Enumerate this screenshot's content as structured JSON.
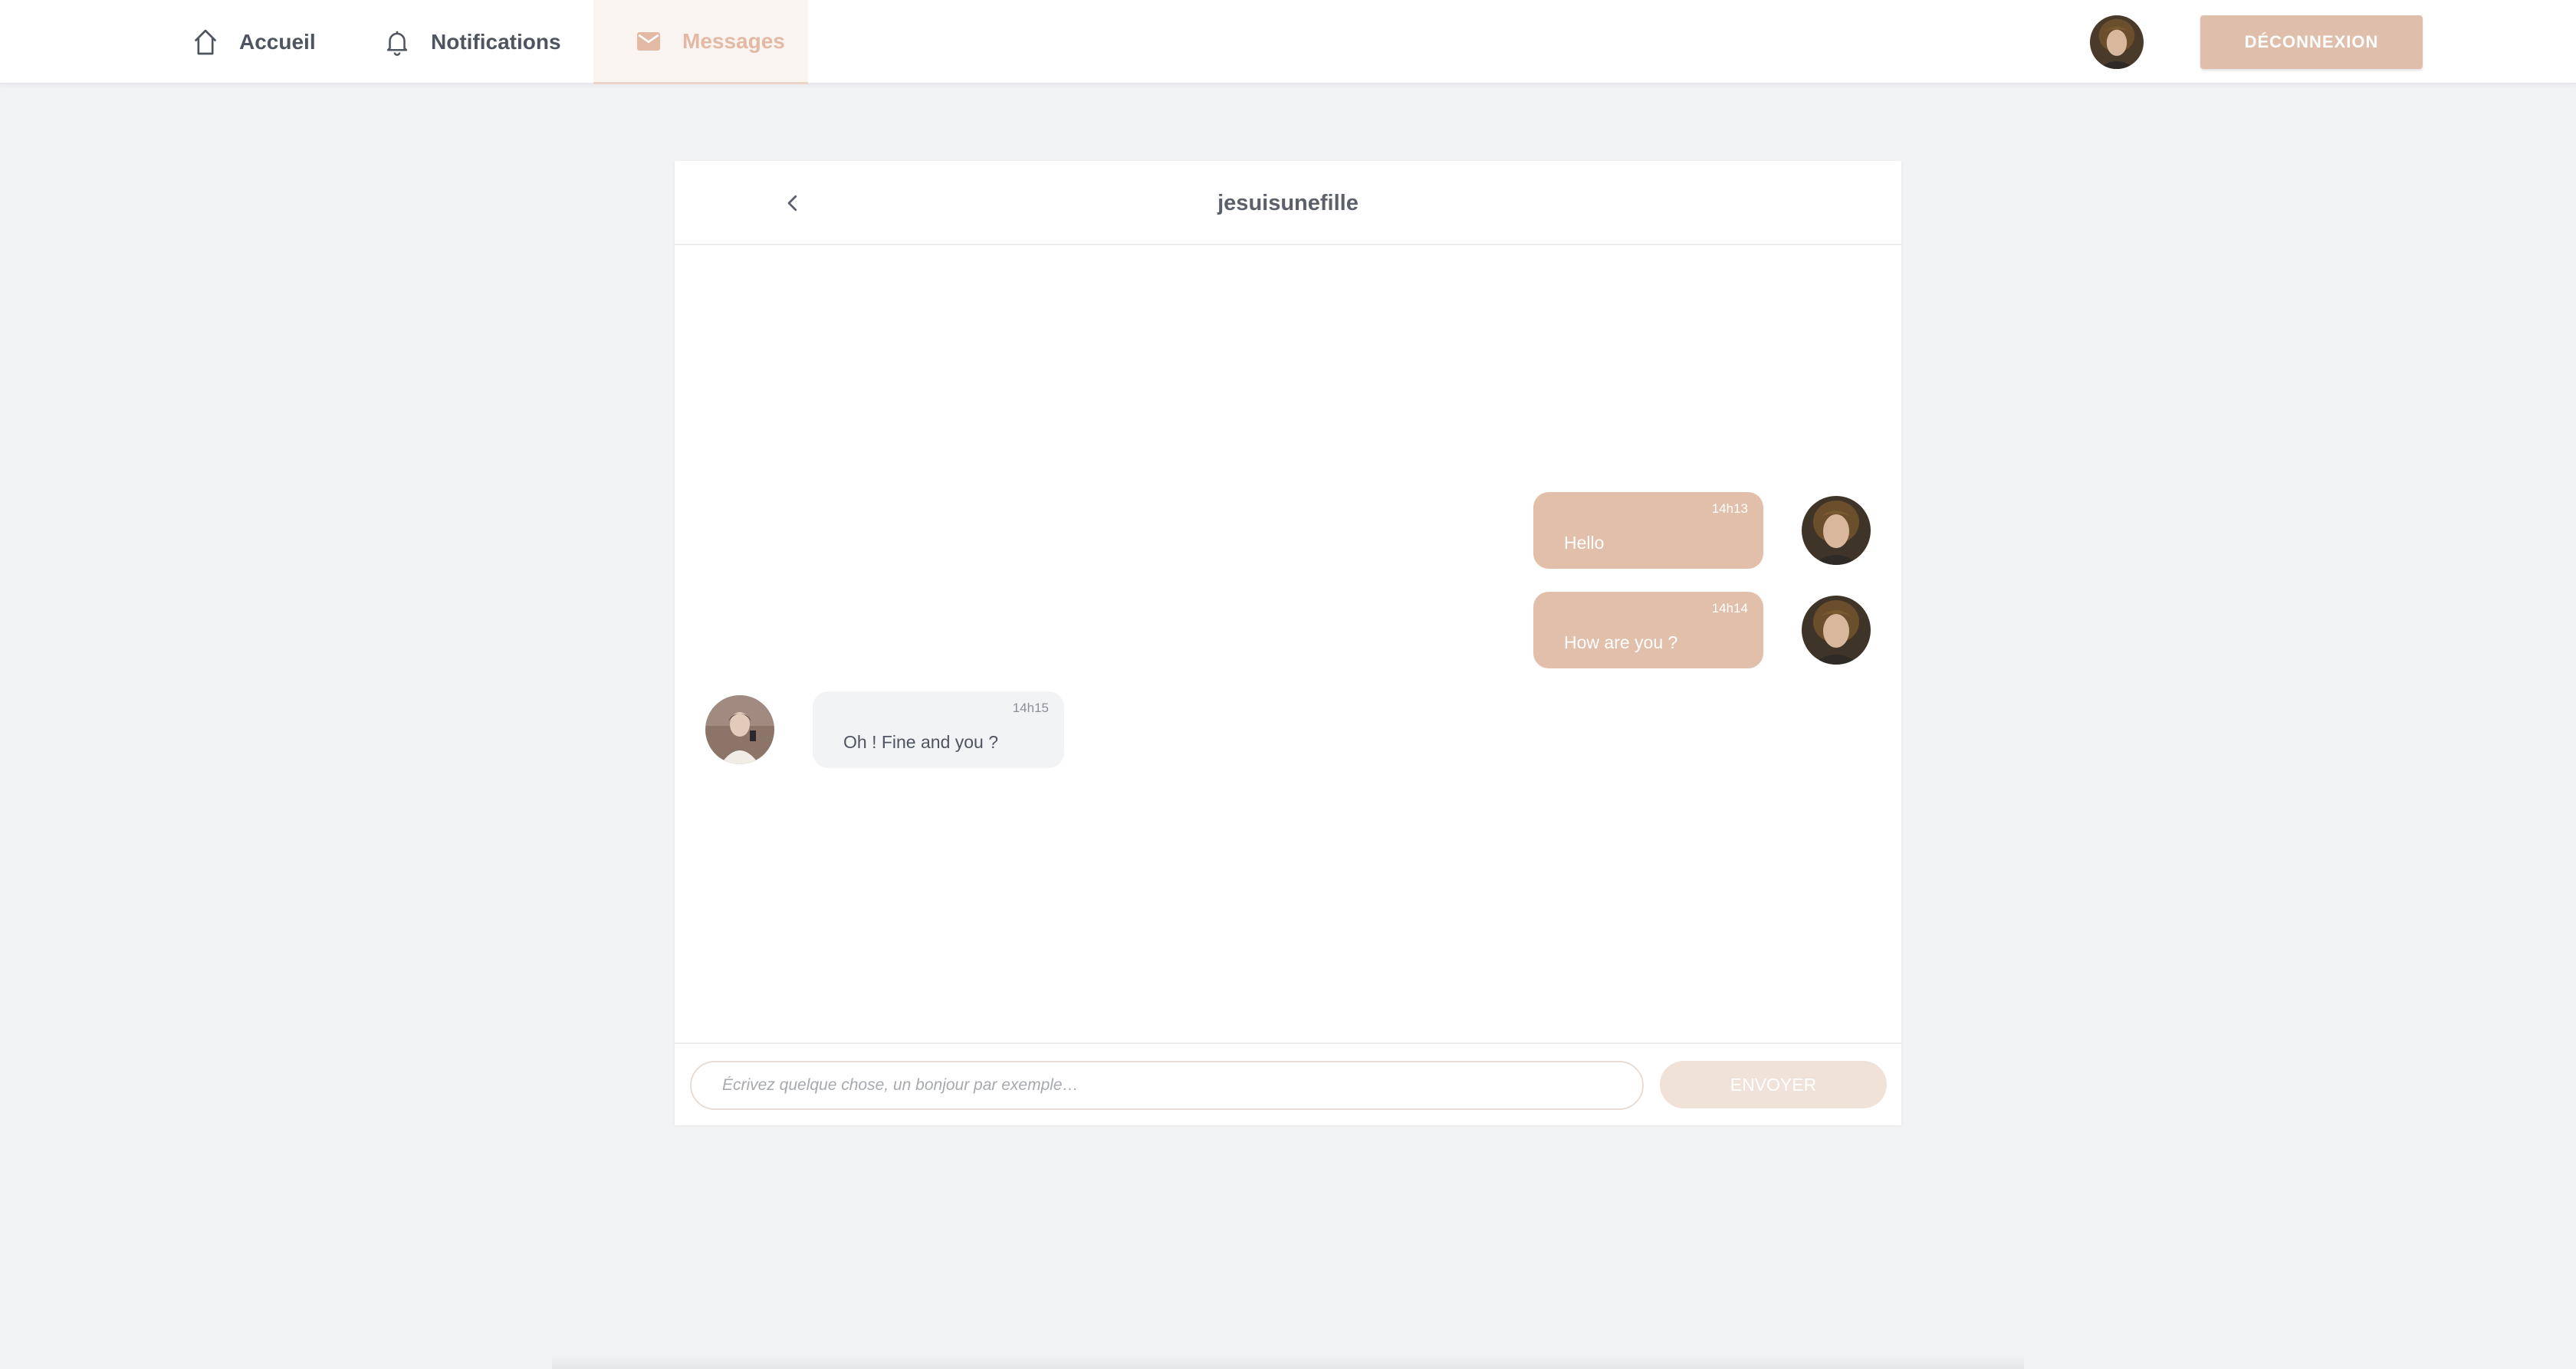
{
  "nav": {
    "items": [
      {
        "label": "Accueil",
        "icon": "home-icon"
      },
      {
        "label": "Notifications",
        "icon": "bell-icon"
      },
      {
        "label": "Messages",
        "icon": "mail-icon",
        "active": true
      }
    ],
    "logout_label": "DÉCONNEXION"
  },
  "chat": {
    "title": "jesuisunefille",
    "messages": [
      {
        "from": "me",
        "time": "14h13",
        "text": "Hello"
      },
      {
        "from": "me",
        "time": "14h14",
        "text": "How are you ?"
      },
      {
        "from": "them",
        "time": "14h15",
        "text": "Oh ! Fine and you ?"
      }
    ],
    "input_placeholder": "Écrivez quelque chose, un bonjour par exemple…",
    "input_value": "",
    "send_label": "ENVOYER"
  },
  "colors": {
    "accent": "#e2bfab",
    "accent_light": "#f1e2d9",
    "background": "#f2f3f5"
  }
}
